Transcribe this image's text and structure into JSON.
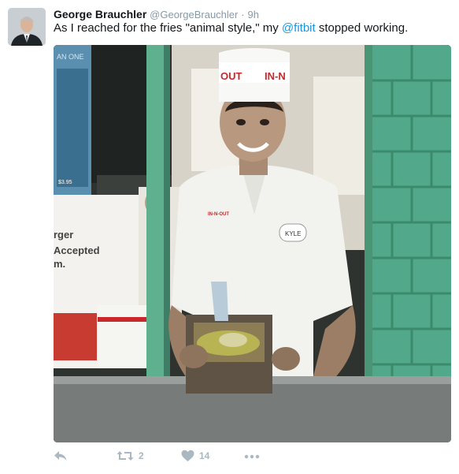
{
  "tweet": {
    "author_name": "George Brauchler",
    "author_handle": "@GeorgeBrauchler",
    "separator": "·",
    "time": "9h",
    "text_before": "As I reached for the fries \"animal style,\" my ",
    "mention": "@fitbit",
    "text_after": " stopped working."
  },
  "media": {
    "hat_brand_left": "OUT",
    "hat_brand_right": "IN-N",
    "shirt_logo": "IN-N-OUT",
    "name_tag": "KYLE",
    "sign_text_top": "AN ONE",
    "sign_price": "$3.95",
    "sign_words": [
      "rger",
      "Accepted",
      "m."
    ]
  },
  "actions": {
    "reply_icon": "reply-icon",
    "retweet_icon": "retweet-icon",
    "retweet_count": "2",
    "like_icon": "heart-icon",
    "like_count": "14",
    "more_icon": "more-icon"
  },
  "colors": {
    "accent": "#1b95e0",
    "name": "#14171a",
    "muted": "#8899a6",
    "action_gray": "#aab8c2",
    "wall_green": "#52a88a"
  }
}
